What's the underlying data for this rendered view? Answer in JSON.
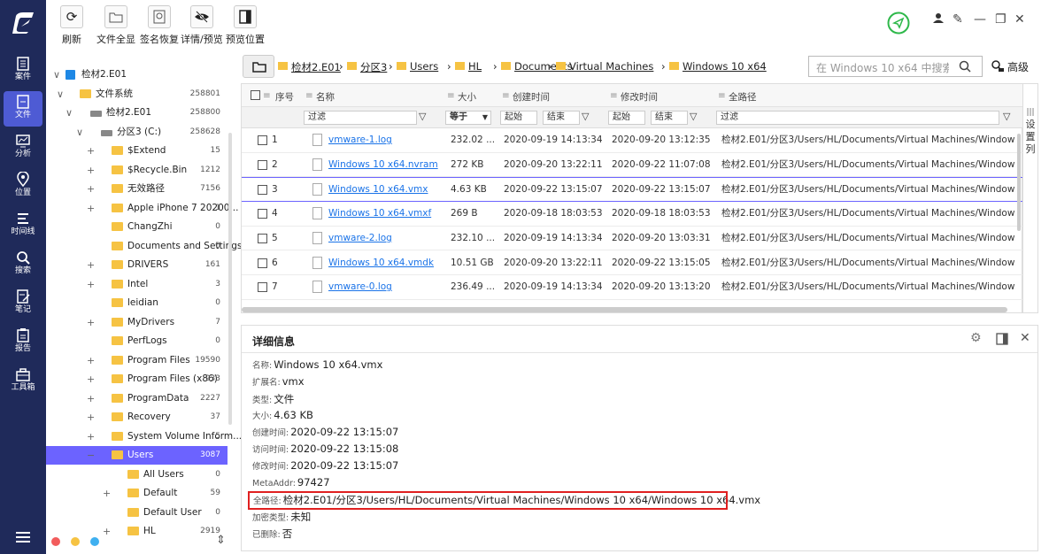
{
  "nav": {
    "items": [
      {
        "label": "案件"
      },
      {
        "label": "文件"
      },
      {
        "label": "分析"
      },
      {
        "label": "位置"
      },
      {
        "label": "时间线"
      },
      {
        "label": "搜索"
      },
      {
        "label": "笔记"
      },
      {
        "label": "报告"
      },
      {
        "label": "工具箱"
      }
    ],
    "active": "文件"
  },
  "toolbar": {
    "refresh": "刷新",
    "file_all": "文件全显",
    "sig_recover": "签名恢复",
    "detail_preview": "详情/预览",
    "preview_pos": "预览位置"
  },
  "tree": {
    "rows": [
      {
        "label": "检材2.E01",
        "count": ""
      },
      {
        "label": "文件系统",
        "count": "258801"
      },
      {
        "label": "检材2.E01",
        "count": "258800"
      },
      {
        "label": "分区3 (C:)",
        "count": "258628"
      },
      {
        "label": "$Extend",
        "count": "15"
      },
      {
        "label": "$Recycle.Bin",
        "count": "1212"
      },
      {
        "label": "无效路径",
        "count": "7156"
      },
      {
        "label": "Apple iPhone 7 20200...",
        "count": "1"
      },
      {
        "label": "ChangZhi",
        "count": "0"
      },
      {
        "label": "Documents and Settings",
        "count": "0"
      },
      {
        "label": "DRIVERS",
        "count": "161"
      },
      {
        "label": "Intel",
        "count": "3"
      },
      {
        "label": "leidian",
        "count": "0"
      },
      {
        "label": "MyDrivers",
        "count": "7"
      },
      {
        "label": "PerfLogs",
        "count": "0"
      },
      {
        "label": "Program Files",
        "count": "19590"
      },
      {
        "label": "Program Files (x86)",
        "count": "933"
      },
      {
        "label": "ProgramData",
        "count": "2227"
      },
      {
        "label": "Recovery",
        "count": "37"
      },
      {
        "label": "System Volume Inform...",
        "count": "5"
      },
      {
        "label": "Users",
        "count": "3087"
      },
      {
        "label": "All Users",
        "count": "0"
      },
      {
        "label": "Default",
        "count": "59"
      },
      {
        "label": "Default User",
        "count": "0"
      },
      {
        "label": "HL",
        "count": "2919"
      }
    ]
  },
  "path": {
    "crumbs": [
      "检材2.E01",
      "分区3",
      "Users",
      "HL",
      "Documents",
      "Virtual Machines",
      "Windows 10 x64"
    ],
    "search_placeholder": "在 Windows 10 x64 中搜索",
    "advanced": "高级"
  },
  "grid": {
    "headers": {
      "seq": "序号",
      "name": "名称",
      "size": "大小",
      "created": "创建时间",
      "modified": "修改时间",
      "fullpath": "全路径"
    },
    "filters": {
      "name": "过滤",
      "size": "等于",
      "c_start": "起始",
      "c_end": "结束",
      "m_start": "起始",
      "m_end": "结束",
      "path": "过滤"
    },
    "settings_label": "设置列",
    "rows": [
      {
        "seq": "1",
        "name": "vmware-1.log",
        "size": "232.02 ...",
        "created": "2020-09-19 14:13:34",
        "modified": "2020-09-20 13:12:35",
        "path": "检材2.E01/分区3/Users/HL/Documents/Virtual Machines/Windows 1..."
      },
      {
        "seq": "2",
        "name": "Windows 10 x64.nvram",
        "size": "272 KB",
        "created": "2020-09-20 13:22:11",
        "modified": "2020-09-22 11:07:08",
        "path": "检材2.E01/分区3/Users/HL/Documents/Virtual Machines/Windows 1..."
      },
      {
        "seq": "3",
        "name": "Windows 10 x64.vmx",
        "size": "4.63 KB",
        "created": "2020-09-22 13:15:07",
        "modified": "2020-09-22 13:15:07",
        "path": "检材2.E01/分区3/Users/HL/Documents/Virtual Machines/Windows 1..."
      },
      {
        "seq": "4",
        "name": "Windows 10 x64.vmxf",
        "size": "269 B",
        "created": "2020-09-18 18:03:53",
        "modified": "2020-09-18 18:03:53",
        "path": "检材2.E01/分区3/Users/HL/Documents/Virtual Machines/Windows 1..."
      },
      {
        "seq": "5",
        "name": "vmware-2.log",
        "size": "232.10 ...",
        "created": "2020-09-19 14:13:34",
        "modified": "2020-09-20 13:03:31",
        "path": "检材2.E01/分区3/Users/HL/Documents/Virtual Machines/Windows 1..."
      },
      {
        "seq": "6",
        "name": "Windows 10 x64.vmdk",
        "size": "10.51 GB",
        "created": "2020-09-20 13:22:11",
        "modified": "2020-09-22 13:15:05",
        "path": "检材2.E01/分区3/Users/HL/Documents/Virtual Machines/Windows 1..."
      },
      {
        "seq": "7",
        "name": "vmware-0.log",
        "size": "236.49 ...",
        "created": "2020-09-19 14:13:34",
        "modified": "2020-09-20 13:13:20",
        "path": "检材2.E01/分区3/Users/HL/Documents/Virtual Machines/Windows 1..."
      }
    ]
  },
  "detail": {
    "title": "详细信息",
    "fields": [
      {
        "k": "名称:",
        "v": "Windows 10 x64.vmx"
      },
      {
        "k": "扩展名:",
        "v": "vmx"
      },
      {
        "k": "类型:",
        "v": "文件"
      },
      {
        "k": "大小:",
        "v": "4.63 KB"
      },
      {
        "k": "创建时间:",
        "v": "2020-09-22 13:15:07"
      },
      {
        "k": "访问时间:",
        "v": "2020-09-22 13:15:08"
      },
      {
        "k": "修改时间:",
        "v": "2020-09-22 13:15:07"
      },
      {
        "k": "MetaAddr:",
        "v": "97427"
      },
      {
        "k": "全路径:",
        "v": "检材2.E01/分区3/Users/HL/Documents/Virtual Machines/Windows 10 x64/Windows 10 x64.vmx"
      },
      {
        "k": "加密类型:",
        "v": "未知"
      },
      {
        "k": "已删除:",
        "v": "否"
      }
    ]
  },
  "colors": {
    "sidebar": "#1f2a5a",
    "accent": "#6c63ff",
    "link": "#1a73e8",
    "highlight": "#e02020",
    "folder": "#f6c343"
  }
}
